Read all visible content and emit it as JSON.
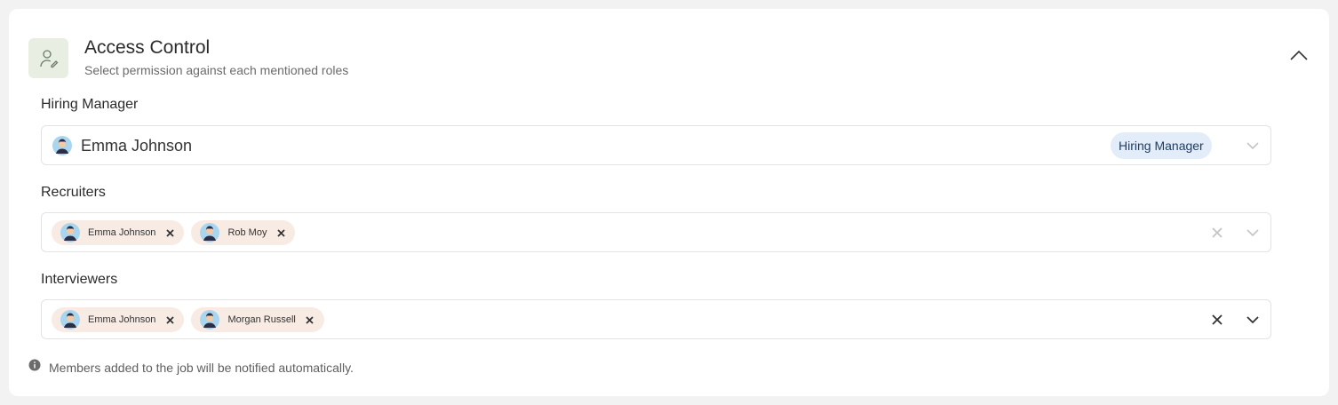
{
  "header": {
    "title": "Access Control",
    "subtitle": "Select permission against each mentioned roles",
    "icon": "user-edit-icon",
    "collapse_icon": "chevron-up-icon"
  },
  "hiring_manager": {
    "label": "Hiring Manager",
    "selected_user": "Emma Johnson",
    "role_badge": "Hiring Manager"
  },
  "recruiters": {
    "label": "Recruiters",
    "chips": [
      "Emma Johnson",
      "Rob Moy"
    ]
  },
  "interviewers": {
    "label": "Interviewers",
    "chips": [
      "Emma Johnson",
      "Morgan Russell"
    ]
  },
  "footnote": {
    "icon": "info-icon",
    "text": "Members added to the job will be notified automatically."
  },
  "colors": {
    "header_icon_bg": "#e8efe2",
    "chip_bg": "#f8ebe4",
    "badge_bg": "#e2edf9",
    "avatar_bg": "#a9d6ee"
  }
}
